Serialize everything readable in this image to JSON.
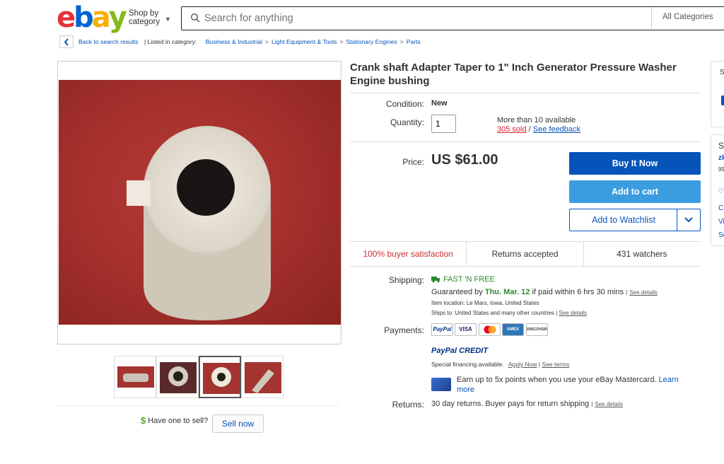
{
  "header": {
    "logo_letters": [
      "e",
      "b",
      "a",
      "y"
    ],
    "logo_colors": [
      "#e53238",
      "#0064d2",
      "#f5af02",
      "#86b817"
    ],
    "shop_by": "Shop by category",
    "search_placeholder": "Search for anything",
    "category": "All Categories"
  },
  "breadcrumb": {
    "back": "Back to search results",
    "listed_in": "| Listed in category:",
    "items": [
      "Business & Industrial",
      "Light Equipment & Tools",
      "Stationary Engines",
      "Parts"
    ]
  },
  "product": {
    "title": "Crank shaft Adapter Taper to 1\" Inch Generator Pressure Washer Engine bushing",
    "condition_label": "Condition:",
    "condition": "New",
    "quantity_label": "Quantity:",
    "quantity": "1",
    "available": "More than 10 available",
    "sold": "305 sold",
    "sold_sep": " / ",
    "feedback": "See feedback",
    "price_label": "Price:",
    "price": "US $61.00"
  },
  "buttons": {
    "buy_now": "Buy It Now",
    "add_cart": "Add to cart",
    "watchlist": "Add to Watchlist"
  },
  "stats": {
    "satisfaction": "100% buyer satisfaction",
    "returns": "Returns accepted",
    "watchers": "431 watchers"
  },
  "shipping": {
    "label": "Shipping:",
    "badge": "FAST 'N FREE",
    "guaranteed_prefix": "Guaranteed by ",
    "guaranteed_date": "Thu. Mar. 12",
    "guaranteed_suffix": " if paid within 6 hrs 30 mins",
    "see_details": "See details",
    "location_label": "Item location:",
    "location": "Le Mars, Iowa, United States",
    "ships_to_label": "Ships to:",
    "ships_to": "United States and many other countries"
  },
  "payments": {
    "label": "Payments:",
    "methods": [
      "PayPal",
      "VISA",
      "MC",
      "AMEX",
      "DISCOVER"
    ],
    "paypal_credit": "PayPal CREDIT",
    "financing": "Special financing available.",
    "apply": "Apply Now",
    "terms": "See terms",
    "mastercard_offer": "Earn up to 5x points when you use your eBay Mastercard.",
    "learn_more": "Learn more"
  },
  "returns": {
    "label": "Returns:",
    "text": "30 day returns. Buyer pays for return shipping",
    "see_details": "See details"
  },
  "sell": {
    "text": "Have one to sell?",
    "button": "Sell now"
  },
  "right_panel": {
    "letters": [
      "S",
      "S",
      "zk",
      "99",
      "C",
      "Vi",
      "Se"
    ]
  }
}
